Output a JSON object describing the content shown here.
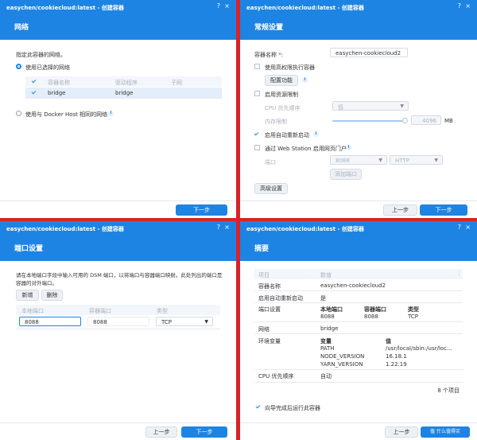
{
  "window_title": "easychen/cookiecloud:latest - 创建容器",
  "network": {
    "header": "网络",
    "prompt": "指定此容器的网络。",
    "use_selected": "使用已选择的网络",
    "columns": [
      "容器名称",
      "驱动程序",
      "子网"
    ],
    "row": {
      "name": "bridge",
      "driver": "bridge",
      "subnet": ""
    },
    "use_host": "使用与 Docker Host 相同的网络",
    "next": "下一步"
  },
  "general": {
    "header": "常规设置",
    "container_name_label": "容器名称",
    "required_mark": "*",
    "container_name_value": "easychen-cookiecloud2",
    "high_privilege": "使用高权限执行容器",
    "config_capabilities": "配置功能",
    "resource_limit": "启用资源限制",
    "cpu_priority_label": "CPU 优先顺序",
    "cpu_priority_value": "低",
    "memory_limit_label": "内存限制",
    "memory_limit_value": "4096",
    "memory_unit": "MB",
    "memory_slider_fraction": 1,
    "auto_restart": "启用自动重新启动",
    "web_portal": "通过 Web Station 启用网页门户",
    "port_label": "端口",
    "port_value": "8088",
    "protocol_value": "HTTP",
    "add_portal": "添加端口",
    "advanced": "高级设置",
    "prev": "上一步",
    "next": "下一步"
  },
  "ports": {
    "header": "端口设置",
    "desc_line1": "请在本地端口字段中输入可用的 DSM 端口，以将端口与容器端口映射。此处列出的端口是",
    "desc_line2": "容器的对外端口。",
    "add": "新增",
    "delete": "删除",
    "columns": [
      "本地端口",
      "容器端口",
      "类型"
    ],
    "row": {
      "local": "8088",
      "container": "8088",
      "type": "TCP"
    },
    "prev": "上一步",
    "next": "下一步"
  },
  "summary": {
    "header": "摘要",
    "col_item": "项目",
    "col_value": "数值",
    "container_name": {
      "label": "容器名称",
      "value": "easychen-cookiecloud2"
    },
    "auto_restart": {
      "label": "启用自动重新启动",
      "value": "是"
    },
    "port_settings": {
      "label": "端口设置",
      "headers": [
        "本地端口",
        "容器端口",
        "类型"
      ],
      "values": [
        "8088",
        "8088",
        "TCP"
      ]
    },
    "network": {
      "label": "网络",
      "value": "bridge"
    },
    "env": {
      "label": "环境变量",
      "var_header": "变量",
      "val_header": "值",
      "rows": [
        {
          "name": "PATH",
          "value": "/usr/local/sbin:/usr/loc..."
        },
        {
          "name": "NODE_VERSION",
          "value": "16.18.1"
        },
        {
          "name": "YARN_VERSION",
          "value": "1.22.19"
        }
      ]
    },
    "cpu_priority": {
      "label": "CPU 优先顺序",
      "value": "自动"
    },
    "count": "8 个项目",
    "run_after": "向导完成后运行此容器",
    "prev": "上一步",
    "next": "下一步"
  },
  "watermark": "值 什么值得买",
  "colors": {
    "accent": "#1d84e3",
    "divider": "#d6232a"
  }
}
